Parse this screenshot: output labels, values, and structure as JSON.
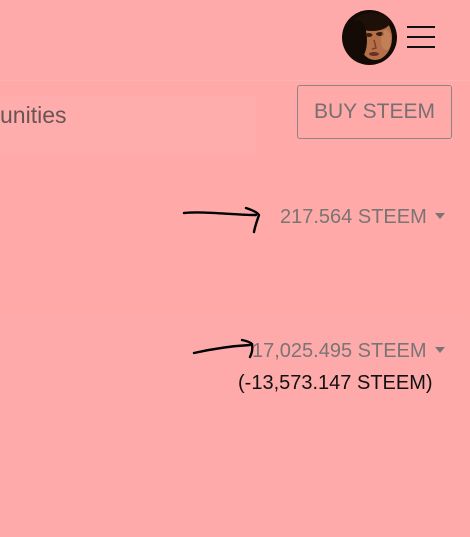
{
  "header": {
    "avatar_icon": "user-avatar",
    "menu_icon": "hamburger-menu-icon"
  },
  "nav": {
    "tab_label": "unities"
  },
  "actions": {
    "buy_label": "BUY STEEM"
  },
  "wallet": {
    "balance_1": "217.564 STEEM",
    "balance_2": "17,025.495 STEEM",
    "balance_2_change": "(-13,573.147 STEEM)"
  },
  "colors": {
    "background": "#ffa9a9",
    "text_muted": "#7a7474",
    "text_dark": "#111111",
    "annotation_ink": "#000000"
  }
}
